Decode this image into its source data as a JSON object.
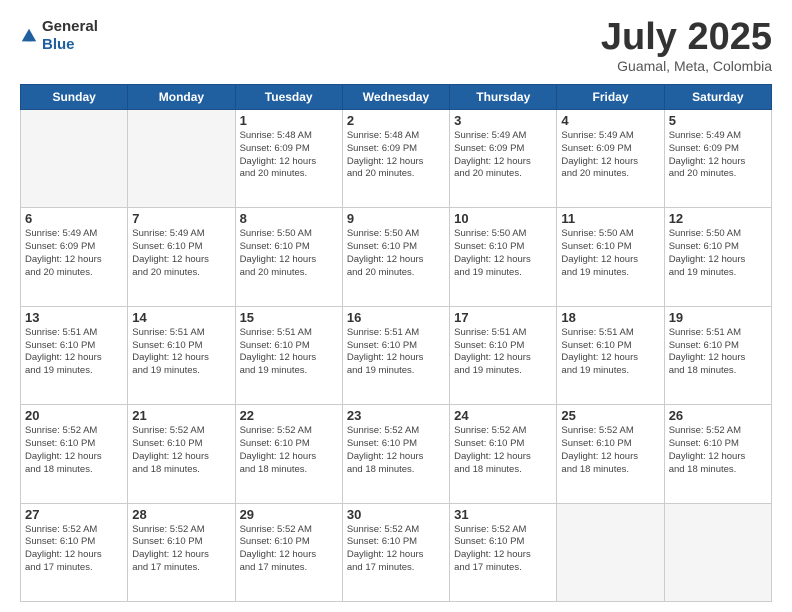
{
  "header": {
    "logo_general": "General",
    "logo_blue": "Blue",
    "month_title": "July 2025",
    "location": "Guamal, Meta, Colombia"
  },
  "days_of_week": [
    "Sunday",
    "Monday",
    "Tuesday",
    "Wednesday",
    "Thursday",
    "Friday",
    "Saturday"
  ],
  "weeks": [
    [
      {
        "day": "",
        "info": ""
      },
      {
        "day": "",
        "info": ""
      },
      {
        "day": "1",
        "info": "Sunrise: 5:48 AM\nSunset: 6:09 PM\nDaylight: 12 hours\nand 20 minutes."
      },
      {
        "day": "2",
        "info": "Sunrise: 5:48 AM\nSunset: 6:09 PM\nDaylight: 12 hours\nand 20 minutes."
      },
      {
        "day": "3",
        "info": "Sunrise: 5:49 AM\nSunset: 6:09 PM\nDaylight: 12 hours\nand 20 minutes."
      },
      {
        "day": "4",
        "info": "Sunrise: 5:49 AM\nSunset: 6:09 PM\nDaylight: 12 hours\nand 20 minutes."
      },
      {
        "day": "5",
        "info": "Sunrise: 5:49 AM\nSunset: 6:09 PM\nDaylight: 12 hours\nand 20 minutes."
      }
    ],
    [
      {
        "day": "6",
        "info": "Sunrise: 5:49 AM\nSunset: 6:09 PM\nDaylight: 12 hours\nand 20 minutes."
      },
      {
        "day": "7",
        "info": "Sunrise: 5:49 AM\nSunset: 6:10 PM\nDaylight: 12 hours\nand 20 minutes."
      },
      {
        "day": "8",
        "info": "Sunrise: 5:50 AM\nSunset: 6:10 PM\nDaylight: 12 hours\nand 20 minutes."
      },
      {
        "day": "9",
        "info": "Sunrise: 5:50 AM\nSunset: 6:10 PM\nDaylight: 12 hours\nand 20 minutes."
      },
      {
        "day": "10",
        "info": "Sunrise: 5:50 AM\nSunset: 6:10 PM\nDaylight: 12 hours\nand 19 minutes."
      },
      {
        "day": "11",
        "info": "Sunrise: 5:50 AM\nSunset: 6:10 PM\nDaylight: 12 hours\nand 19 minutes."
      },
      {
        "day": "12",
        "info": "Sunrise: 5:50 AM\nSunset: 6:10 PM\nDaylight: 12 hours\nand 19 minutes."
      }
    ],
    [
      {
        "day": "13",
        "info": "Sunrise: 5:51 AM\nSunset: 6:10 PM\nDaylight: 12 hours\nand 19 minutes."
      },
      {
        "day": "14",
        "info": "Sunrise: 5:51 AM\nSunset: 6:10 PM\nDaylight: 12 hours\nand 19 minutes."
      },
      {
        "day": "15",
        "info": "Sunrise: 5:51 AM\nSunset: 6:10 PM\nDaylight: 12 hours\nand 19 minutes."
      },
      {
        "day": "16",
        "info": "Sunrise: 5:51 AM\nSunset: 6:10 PM\nDaylight: 12 hours\nand 19 minutes."
      },
      {
        "day": "17",
        "info": "Sunrise: 5:51 AM\nSunset: 6:10 PM\nDaylight: 12 hours\nand 19 minutes."
      },
      {
        "day": "18",
        "info": "Sunrise: 5:51 AM\nSunset: 6:10 PM\nDaylight: 12 hours\nand 19 minutes."
      },
      {
        "day": "19",
        "info": "Sunrise: 5:51 AM\nSunset: 6:10 PM\nDaylight: 12 hours\nand 18 minutes."
      }
    ],
    [
      {
        "day": "20",
        "info": "Sunrise: 5:52 AM\nSunset: 6:10 PM\nDaylight: 12 hours\nand 18 minutes."
      },
      {
        "day": "21",
        "info": "Sunrise: 5:52 AM\nSunset: 6:10 PM\nDaylight: 12 hours\nand 18 minutes."
      },
      {
        "day": "22",
        "info": "Sunrise: 5:52 AM\nSunset: 6:10 PM\nDaylight: 12 hours\nand 18 minutes."
      },
      {
        "day": "23",
        "info": "Sunrise: 5:52 AM\nSunset: 6:10 PM\nDaylight: 12 hours\nand 18 minutes."
      },
      {
        "day": "24",
        "info": "Sunrise: 5:52 AM\nSunset: 6:10 PM\nDaylight: 12 hours\nand 18 minutes."
      },
      {
        "day": "25",
        "info": "Sunrise: 5:52 AM\nSunset: 6:10 PM\nDaylight: 12 hours\nand 18 minutes."
      },
      {
        "day": "26",
        "info": "Sunrise: 5:52 AM\nSunset: 6:10 PM\nDaylight: 12 hours\nand 18 minutes."
      }
    ],
    [
      {
        "day": "27",
        "info": "Sunrise: 5:52 AM\nSunset: 6:10 PM\nDaylight: 12 hours\nand 17 minutes."
      },
      {
        "day": "28",
        "info": "Sunrise: 5:52 AM\nSunset: 6:10 PM\nDaylight: 12 hours\nand 17 minutes."
      },
      {
        "day": "29",
        "info": "Sunrise: 5:52 AM\nSunset: 6:10 PM\nDaylight: 12 hours\nand 17 minutes."
      },
      {
        "day": "30",
        "info": "Sunrise: 5:52 AM\nSunset: 6:10 PM\nDaylight: 12 hours\nand 17 minutes."
      },
      {
        "day": "31",
        "info": "Sunrise: 5:52 AM\nSunset: 6:10 PM\nDaylight: 12 hours\nand 17 minutes."
      },
      {
        "day": "",
        "info": ""
      },
      {
        "day": "",
        "info": ""
      }
    ]
  ]
}
